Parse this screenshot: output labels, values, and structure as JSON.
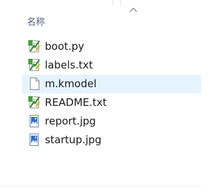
{
  "header": {
    "name_column": "名称"
  },
  "files": [
    {
      "name": "boot.py",
      "icon": "script-file-icon",
      "selected": false
    },
    {
      "name": "labels.txt",
      "icon": "script-file-icon",
      "selected": false
    },
    {
      "name": "m.kmodel",
      "icon": "blank-file-icon",
      "selected": true
    },
    {
      "name": "README.txt",
      "icon": "script-file-icon",
      "selected": false
    },
    {
      "name": "report.jpg",
      "icon": "image-file-icon",
      "selected": false
    },
    {
      "name": "startup.jpg",
      "icon": "image-file-icon",
      "selected": false
    }
  ],
  "colors": {
    "header_text": "#4d6082",
    "selection": "#e5f3ff",
    "text": "#1a1a1a"
  }
}
